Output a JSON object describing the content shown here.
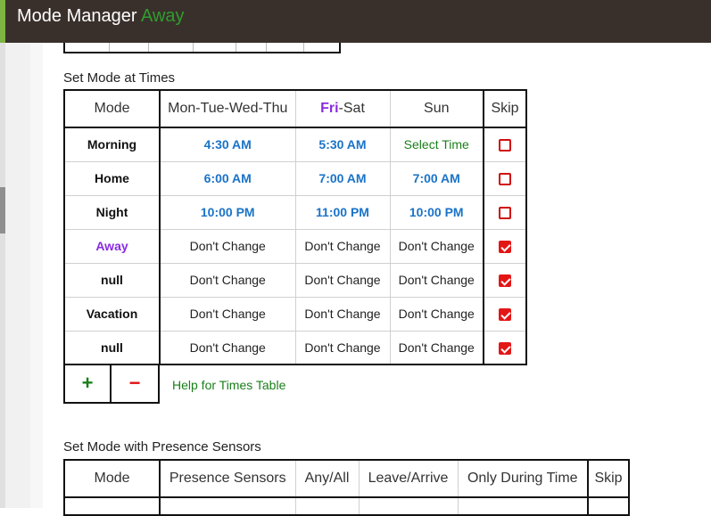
{
  "header": {
    "app_title": "Mode Manager",
    "current_mode": "Away",
    "colors": {
      "background": "#3a302b",
      "accent": "#7cb342",
      "status": "#2e9e2e"
    }
  },
  "times_section": {
    "title": "Set Mode at Times",
    "columns": {
      "mode": "Mode",
      "weekdays": "Mon-Tue-Wed-Thu",
      "fri_bold": "Fri",
      "fri_rest": "-Sat",
      "sun": "Sun",
      "skip": "Skip"
    },
    "rows": [
      {
        "mode": "Morning",
        "weekdays": "4:30 AM",
        "friSat": "5:30 AM",
        "sun": "Select Time",
        "skip": false
      },
      {
        "mode": "Home",
        "weekdays": "6:00 AM",
        "friSat": "7:00 AM",
        "sun": "7:00 AM",
        "skip": false
      },
      {
        "mode": "Night",
        "weekdays": "10:00 PM",
        "friSat": "11:00 PM",
        "sun": "10:00 PM",
        "skip": false
      },
      {
        "mode": "Away",
        "weekdays": "Don't Change",
        "friSat": "Don't Change",
        "sun": "Don't Change",
        "skip": true
      },
      {
        "mode": "null",
        "weekdays": "Don't Change",
        "friSat": "Don't Change",
        "sun": "Don't Change",
        "skip": true
      },
      {
        "mode": "Vacation",
        "weekdays": "Don't Change",
        "friSat": "Don't Change",
        "sun": "Don't Change",
        "skip": true
      },
      {
        "mode": "null",
        "weekdays": "Don't Change",
        "friSat": "Don't Change",
        "sun": "Don't Change",
        "skip": true
      }
    ],
    "add_label": "+",
    "remove_label": "−",
    "help_link": "Help for Times Table"
  },
  "presence_section": {
    "title": "Set Mode with Presence Sensors",
    "columns": {
      "mode": "Mode",
      "sensors": "Presence Sensors",
      "any_all": "Any/All",
      "leave_arrive": "Leave/Arrive",
      "only_during": "Only During Time",
      "skip": "Skip"
    }
  }
}
